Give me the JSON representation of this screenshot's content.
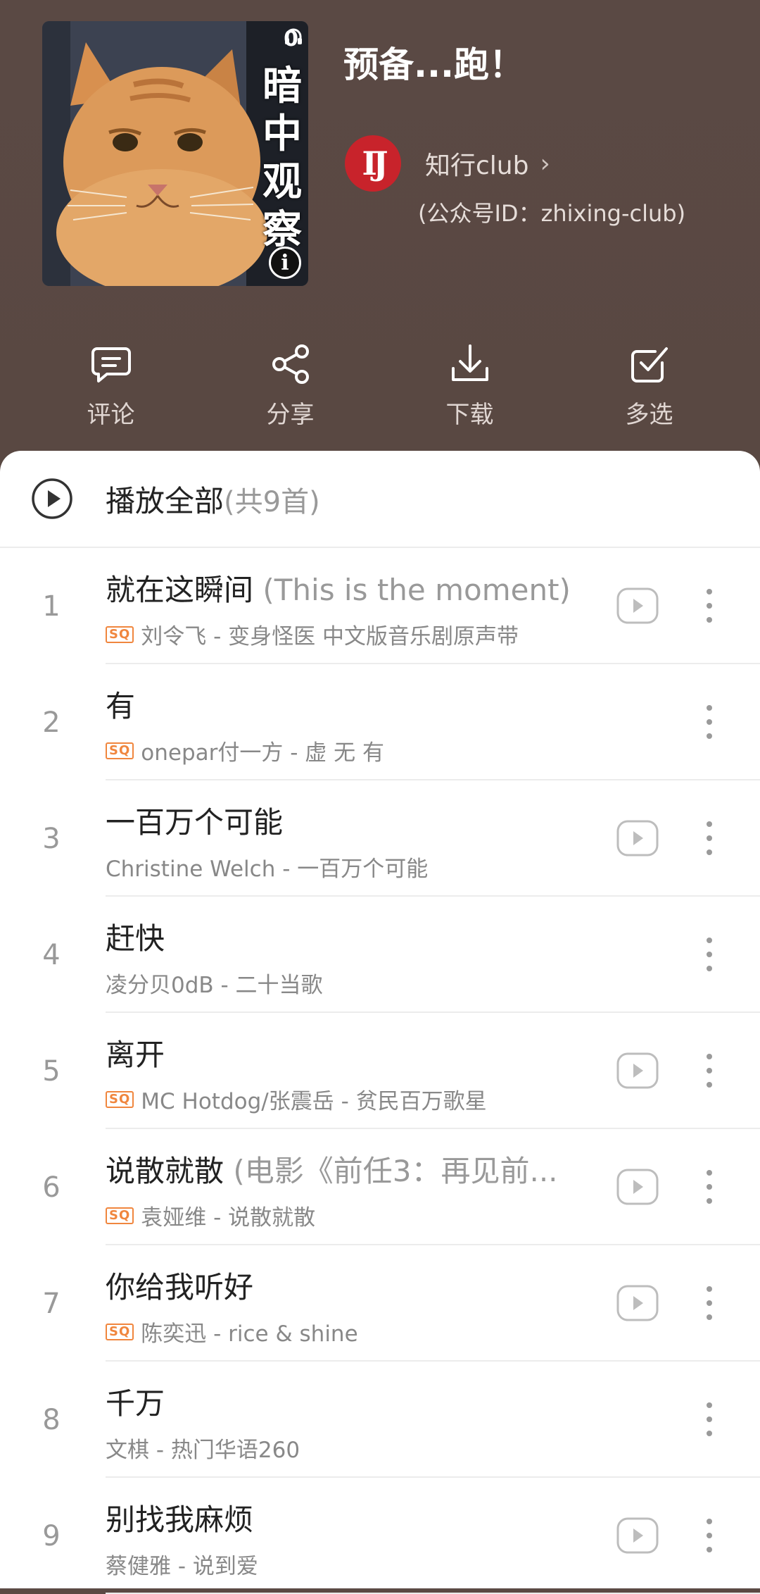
{
  "header": {
    "cover": {
      "listen_count": "0",
      "overlay_text": "暗中观察",
      "info_glyph": "i"
    },
    "title": "预备...跑！",
    "creator": {
      "avatar_text": "IJ",
      "name": "知行club",
      "subtitle": "(公众号ID：zhixing-club)"
    },
    "actions": [
      {
        "label": "评论",
        "icon": "comment-icon"
      },
      {
        "label": "分享",
        "icon": "share-icon"
      },
      {
        "label": "下载",
        "icon": "download-icon"
      },
      {
        "label": "多选",
        "icon": "multi-select-icon"
      }
    ]
  },
  "playlist": {
    "play_all_label": "播放全部",
    "count_text": "(共9首)",
    "songs": [
      {
        "num": "1",
        "title": "就在这瞬间",
        "extra": " (This is the moment)",
        "sq": true,
        "meta": "刘令飞 - 变身怪医 中文版音乐剧原声带",
        "mv": true
      },
      {
        "num": "2",
        "title": "有",
        "extra": "",
        "sq": true,
        "meta": "onepar付一方 - 虚 无 有",
        "mv": false
      },
      {
        "num": "3",
        "title": "一百万个可能",
        "extra": "",
        "sq": false,
        "meta": "Christine Welch - 一百万个可能",
        "mv": true
      },
      {
        "num": "4",
        "title": "赶快",
        "extra": "",
        "sq": false,
        "meta": "凌分贝0dB - 二十当歌",
        "mv": false
      },
      {
        "num": "5",
        "title": "离开",
        "extra": "",
        "sq": true,
        "meta": "MC Hotdog/张震岳 - 贫民百万歌星",
        "mv": true
      },
      {
        "num": "6",
        "title": "说散就散",
        "extra": " (电影《前任3：再见前...",
        "sq": true,
        "meta": "袁娅维 - 说散就散",
        "mv": true
      },
      {
        "num": "7",
        "title": "你给我听好",
        "extra": "",
        "sq": true,
        "meta": "陈奕迅 - rice & shine",
        "mv": true
      },
      {
        "num": "8",
        "title": "千万",
        "extra": "",
        "sq": false,
        "meta": "文棋 - 热门华语260",
        "mv": false
      },
      {
        "num": "9",
        "title": "别找我麻烦",
        "extra": "",
        "sq": false,
        "meta": "蔡健雅 - 说到爱",
        "mv": true
      }
    ],
    "sq_badge": "SQ"
  }
}
